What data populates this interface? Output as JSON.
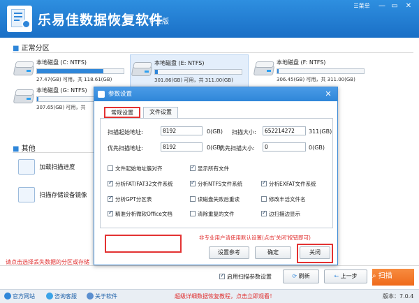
{
  "app": {
    "title": "乐易佳数据恢复软件",
    "edition": "专业版",
    "menu_label": "菜单",
    "win_min": "—",
    "win_restore": "▭",
    "win_close": "✕"
  },
  "sections": {
    "normal": "正常分区",
    "other": "其他"
  },
  "disks": [
    {
      "name": "本地磁盘 (C: NTFS)",
      "size": "27.47(GB) 可用，共 118.61(GB)",
      "used_fraction": 0.77
    },
    {
      "name": "本地磁盘 (E: NTFS)",
      "size": "301.86(GB) 可用，共 311.00(GB)",
      "used_fraction": 0.03
    },
    {
      "name": "本地磁盘 (F: NTFS)",
      "size": "306.45(GB) 可用，共 311.00(GB)",
      "used_fraction": 0.02
    },
    {
      "name": "本地磁盘 (G: NTFS)",
      "size": "307.65(GB) 可用，共",
      "used_fraction": 0.02
    }
  ],
  "other_links": {
    "load_progress": "加载扫描进度",
    "scan_image": "扫描存储设备镜像"
  },
  "left_hint": "请点击选择丢失数据的分区或存储",
  "bottom": {
    "enable_params": "启用扫描参数设置",
    "refresh": "刷新",
    "prev": "上一步",
    "scan": "扫描"
  },
  "statusbar": {
    "site": "官方网站",
    "consult": "咨询客服",
    "about": "关于软件",
    "promo": "超级详细数据恢复教程，点击立即观看！",
    "version": "版本：7.0.4"
  },
  "dialog": {
    "title": "参数设置",
    "close": "✕",
    "tabs": [
      "常规设置",
      "文件设置"
    ],
    "fields": {
      "scan_start_label": "扫描起始地址:",
      "scan_start_value": "8192",
      "scan_start_unit": "0(GB)",
      "scan_size_label": "扫描大小:",
      "scan_size_value": "652214272",
      "scan_size_unit": "311(GB)",
      "priority_addr_label": "优先扫描地址:",
      "priority_addr_value": "8192",
      "priority_addr_unit": "0(GB)",
      "priority_size_label": "优先扫描大小:",
      "priority_size_value": "0",
      "priority_size_unit": "0(GB)"
    },
    "options": [
      {
        "label": "文件起始地址簇对齐",
        "checked": false
      },
      {
        "label": "显示所有文件",
        "checked": true
      },
      {
        "label": "分析FAT/FAT32文件系统",
        "checked": true
      },
      {
        "label": "分析NTFS文件系统",
        "checked": true
      },
      {
        "label": "分析EXFAT文件系统",
        "checked": true
      },
      {
        "label": "分析GPT分区表",
        "checked": true
      },
      {
        "label": "读磁盘失败后重读",
        "checked": false
      },
      {
        "label": "修改丰活文件名",
        "checked": false
      },
      {
        "label": "精准分析微软Office文档",
        "checked": true
      },
      {
        "label": "清除重复的文件",
        "checked": false
      },
      {
        "label": "边扫描边显示",
        "checked": true
      }
    ],
    "hint": "非专业用户请使用默认设置(点击'关闭'按钮即可)",
    "btn_ref": "设置参考",
    "btn_ok": "确定",
    "btn_close": "关闭"
  },
  "colors": {
    "titlebar": "#1f78d1",
    "accent_red": "#e33232",
    "scan_orange": "#ef6a1b"
  }
}
